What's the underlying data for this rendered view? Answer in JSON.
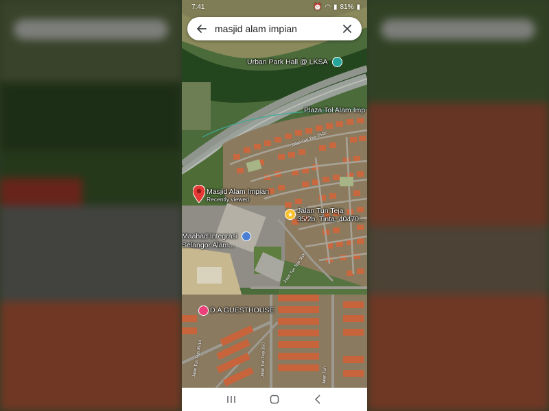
{
  "status_bar": {
    "time": "7:41",
    "battery": "81%"
  },
  "search": {
    "query": "masjid alam impian"
  },
  "icons": {
    "back": "arrow-back-icon",
    "clear": "close-icon",
    "nav_recents": "recents-icon",
    "nav_home": "home-icon",
    "nav_back": "chevron-left-icon"
  },
  "map": {
    "places": [
      {
        "id": "urban-park",
        "name": "Urban Park Hall @ LKSA"
      },
      {
        "id": "plaza-tol",
        "name": "Plaza Tol Alam Imp"
      },
      {
        "id": "masjid",
        "name": "Masjid Alam Impian",
        "subtitle": "Recently viewed"
      },
      {
        "id": "jalan-tun-teja",
        "name": "Jalan Tun Teja",
        "subtitle": "35/2b, Tinta, 40470..."
      },
      {
        "id": "maahad",
        "name": "Maahad Integrasi",
        "subtitle": "Selangor Alam..."
      },
      {
        "id": "guesthouse",
        "name": "D.A GUESTHOUSE"
      }
    ],
    "roads": [
      {
        "name": "Jalan Tun Teja 35/7"
      },
      {
        "name": "Jalan Tun Teja 35/14"
      },
      {
        "name": "Jalan Tun"
      },
      {
        "name": "Jalan Tun Teja 35/2c"
      },
      {
        "name": "Jalan Tun Teja 35/5"
      }
    ]
  },
  "colors": {
    "pin_red": "#e53935",
    "park_teal": "#26a69a",
    "school_blue": "#4a7fd4",
    "hotel_pink": "#ec407a",
    "star_yellow": "#fbc02d"
  }
}
